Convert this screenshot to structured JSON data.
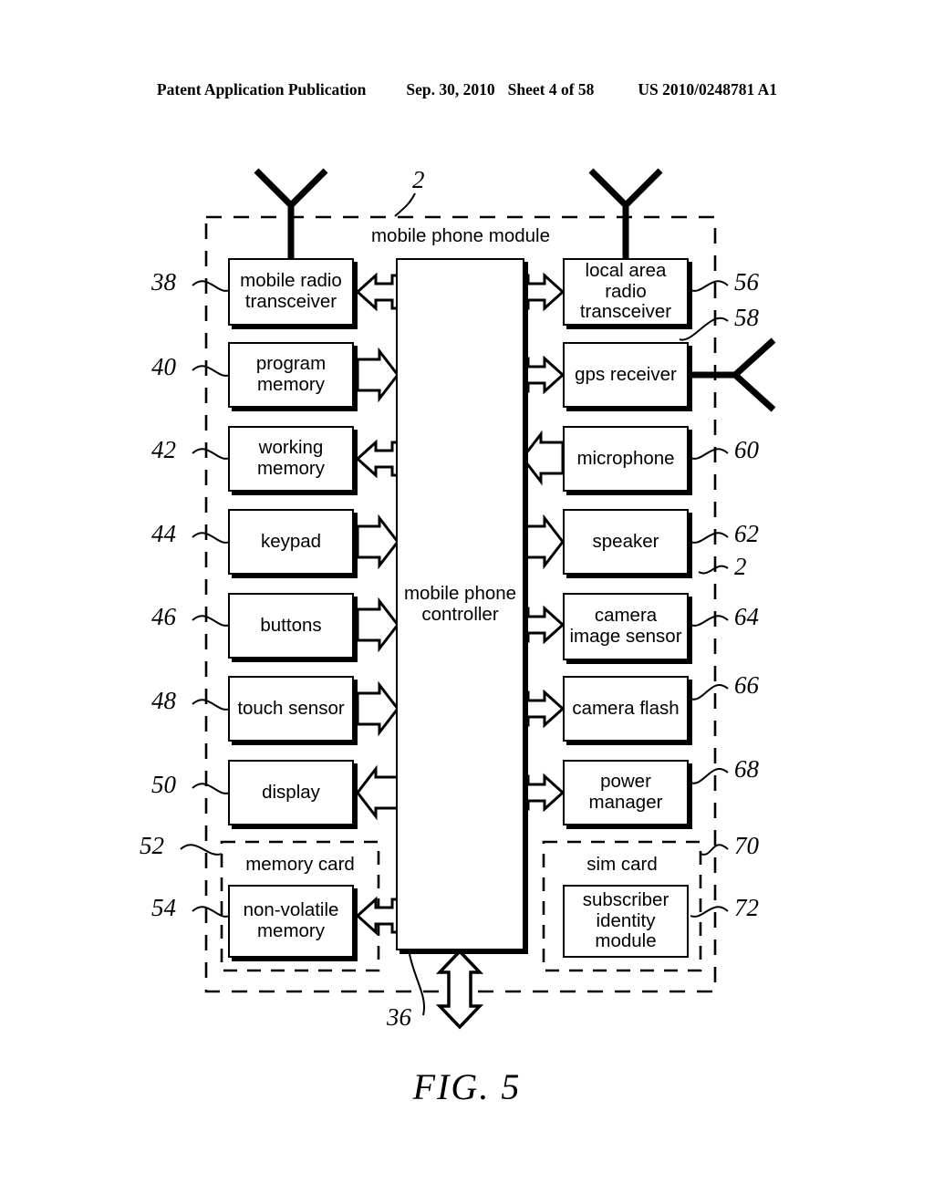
{
  "header": {
    "publication": "Patent Application Publication",
    "date": "Sep. 30, 2010",
    "sheet": "Sheet 4 of 58",
    "number": "US 2010/0248781 A1"
  },
  "figure": {
    "caption": "FIG. 5",
    "module_title": "mobile phone module",
    "controller_label": "mobile phone controller",
    "memory_card_title": "memory card",
    "sim_card_title": "sim card"
  },
  "blocks": {
    "left": [
      {
        "label": "mobile radio transceiver",
        "ref": "38",
        "link": "bidir"
      },
      {
        "label": "program memory",
        "ref": "40",
        "link": "to-controller"
      },
      {
        "label": "working memory",
        "ref": "42",
        "link": "bidir"
      },
      {
        "label": "keypad",
        "ref": "44",
        "link": "to-controller"
      },
      {
        "label": "buttons",
        "ref": "46",
        "link": "to-controller"
      },
      {
        "label": "touch sensor",
        "ref": "48",
        "link": "to-controller"
      },
      {
        "label": "display",
        "ref": "50",
        "link": "from-controller"
      },
      {
        "label": "non-volatile memory",
        "ref": "54",
        "link": "bidir"
      }
    ],
    "right": [
      {
        "label": "local area radio transceiver",
        "ref": "56",
        "link": "bidir"
      },
      {
        "label": "gps receiver",
        "ref": "58",
        "link": "bidir"
      },
      {
        "label": "microphone",
        "ref": "60",
        "link": "to-controller"
      },
      {
        "label": "speaker",
        "ref": "62",
        "link": "from-controller"
      },
      {
        "label": "camera image sensor",
        "ref": "64",
        "link": "bidir"
      },
      {
        "label": "camera flash",
        "ref": "66",
        "link": "bidir"
      },
      {
        "label": "power manager",
        "ref": "68",
        "link": "bidir"
      },
      {
        "label": "subscriber identity module",
        "ref": "72",
        "link": "none"
      }
    ]
  },
  "refs": {
    "module_top": "2",
    "module_side": "2",
    "memory_card": "52",
    "sim_card": "70",
    "bus": "36"
  }
}
